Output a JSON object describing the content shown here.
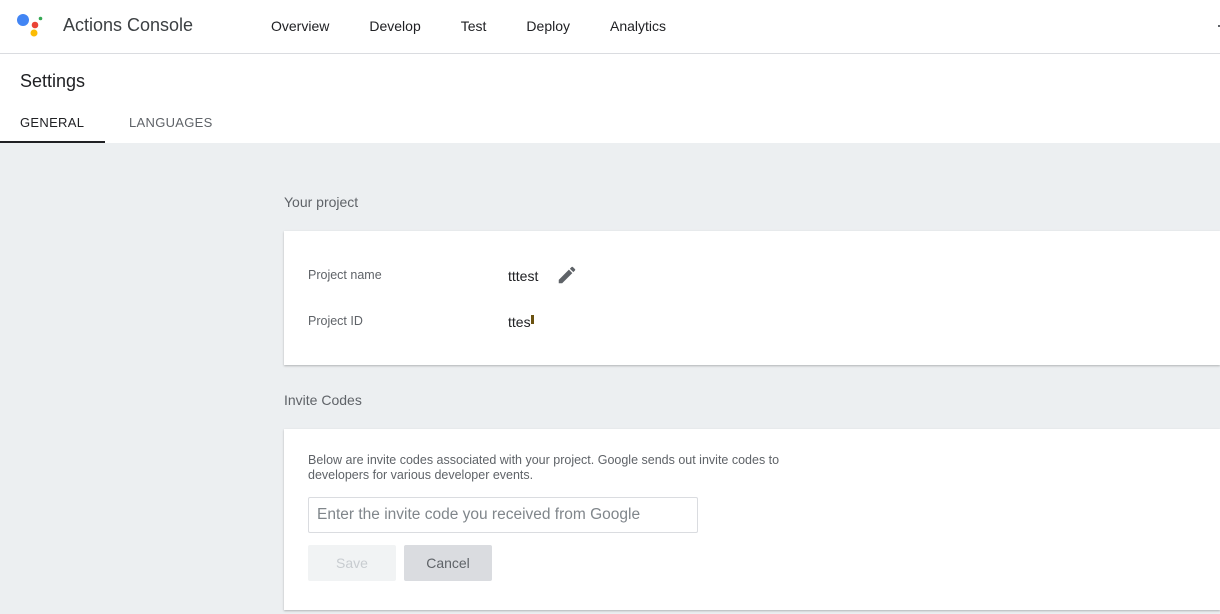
{
  "header": {
    "app_title": "Actions Console",
    "nav": [
      "Overview",
      "Develop",
      "Test",
      "Deploy",
      "Analytics"
    ],
    "logo_colors": {
      "blue": "#4285f4",
      "red": "#ea4335",
      "yellow": "#fbbc04",
      "green": "#34a853"
    }
  },
  "page": {
    "title": "Settings",
    "tabs": [
      "GENERAL",
      "LANGUAGES"
    ],
    "active_tab": "GENERAL"
  },
  "project": {
    "section_title": "Your project",
    "name_label": "Project name",
    "name_value": "tttest",
    "id_label": "Project ID",
    "id_value": "ttes",
    "edit_icon": "pencil-icon"
  },
  "invite": {
    "section_title": "Invite Codes",
    "description": "Below are invite codes associated with your project. Google sends out invite codes to developers for various developer events.",
    "input_placeholder": "Enter the invite code you received from Google",
    "input_value": "",
    "save_label": "Save",
    "cancel_label": "Cancel"
  }
}
